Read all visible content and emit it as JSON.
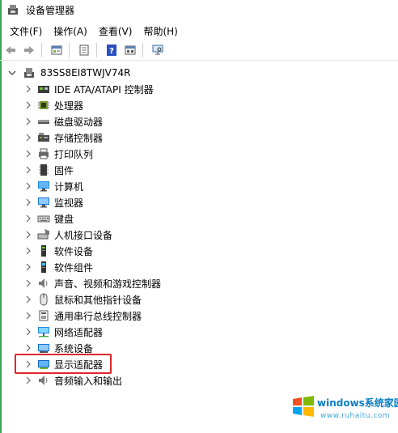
{
  "window": {
    "title": "设备管理器"
  },
  "menu": [
    "文件(F)",
    "操作(A)",
    "查看(V)",
    "帮助(H)"
  ],
  "toolbar": [
    "back-icon",
    "forward-icon",
    "properties-icon",
    "update-driver-icon",
    "help-icon",
    "view-icon",
    "scan-hardware-icon"
  ],
  "tree": {
    "root": "83SS8EI8TWJV74R",
    "items": [
      {
        "label": "IDE ATA/ATAPI 控制器",
        "icon": "ide-controller-icon"
      },
      {
        "label": "处理器",
        "icon": "processor-icon"
      },
      {
        "label": "磁盘驱动器",
        "icon": "disk-drive-icon"
      },
      {
        "label": "存储控制器",
        "icon": "storage-controller-icon"
      },
      {
        "label": "打印队列",
        "icon": "print-queue-icon"
      },
      {
        "label": "固件",
        "icon": "firmware-icon"
      },
      {
        "label": "计算机",
        "icon": "computer-icon"
      },
      {
        "label": "监视器",
        "icon": "monitor-icon"
      },
      {
        "label": "键盘",
        "icon": "keyboard-icon"
      },
      {
        "label": "人机接口设备",
        "icon": "hid-icon"
      },
      {
        "label": "软件设备",
        "icon": "software-device-icon"
      },
      {
        "label": "软件组件",
        "icon": "software-component-icon"
      },
      {
        "label": "声音、视频和游戏控制器",
        "icon": "sound-icon"
      },
      {
        "label": "鼠标和其他指针设备",
        "icon": "mouse-icon"
      },
      {
        "label": "通用串行总线控制器",
        "icon": "usb-icon"
      },
      {
        "label": "网络适配器",
        "icon": "network-adapter-icon"
      },
      {
        "label": "系统设备",
        "icon": "system-device-icon"
      },
      {
        "label": "显示适配器",
        "icon": "display-adapter-icon",
        "highlighted": true
      },
      {
        "label": "音频输入和输出",
        "icon": "audio-io-icon"
      }
    ]
  },
  "watermark": {
    "brand": "windows系统家园",
    "url": "www.ruhaitu.com"
  },
  "colors": {
    "highlight": "#e0262b",
    "accent_bar": "#3aa655"
  }
}
